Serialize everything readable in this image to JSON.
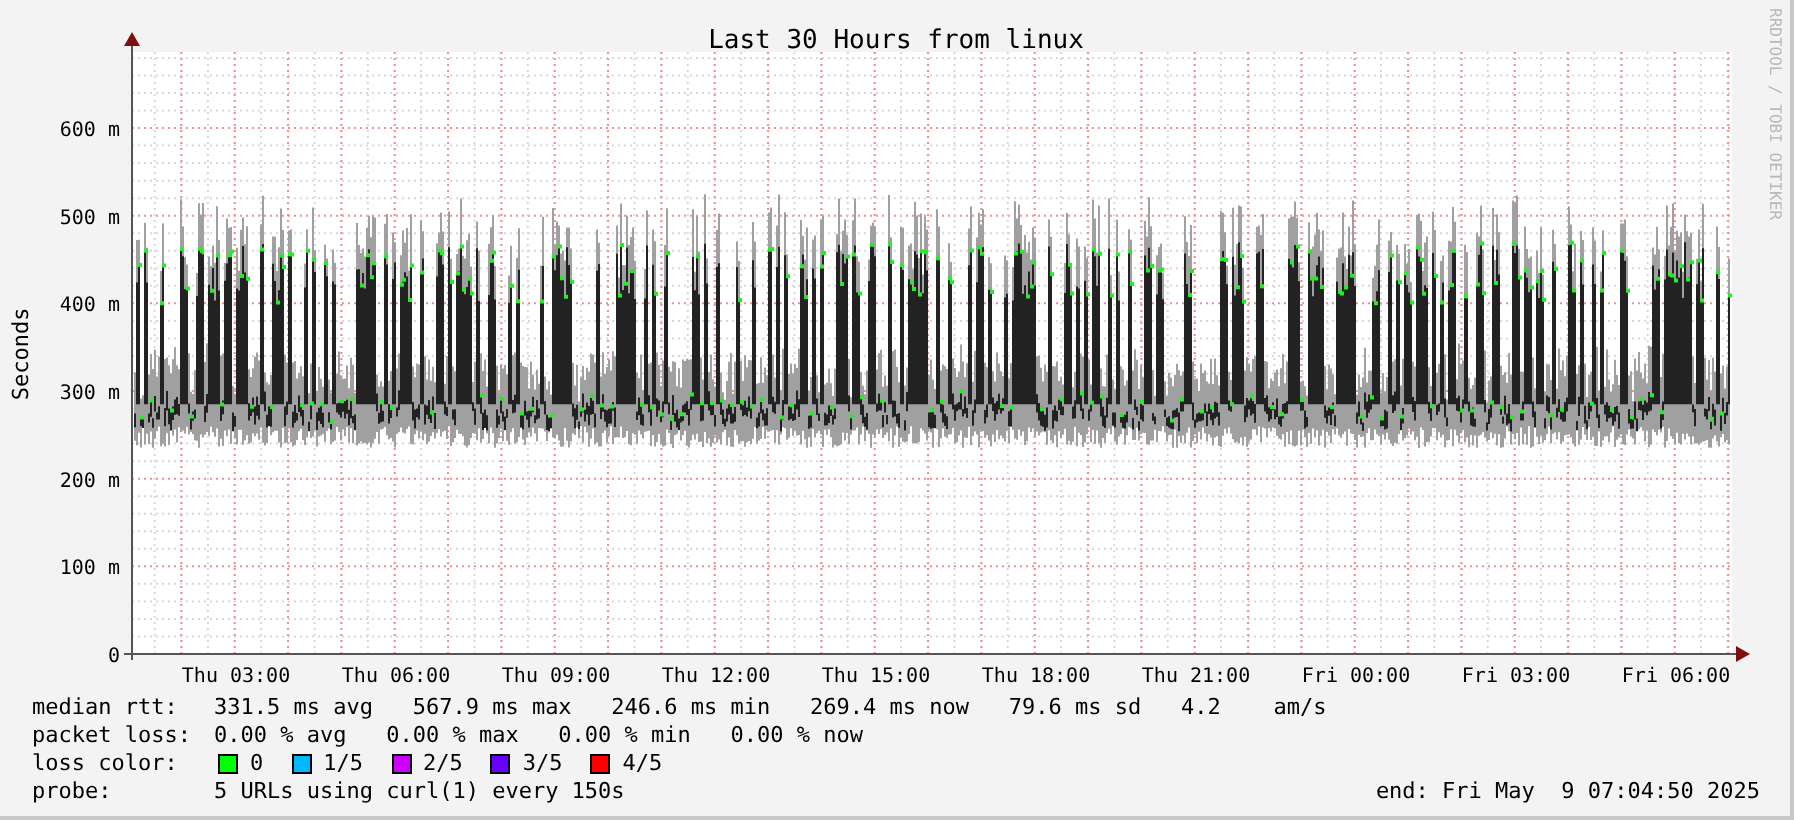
{
  "chart": {
    "title": "Last 30 Hours from linux",
    "ylabel": "Seconds",
    "credit": "RRDTOOL / TOBI OETIKER",
    "yticks": [
      "600 m",
      "500 m",
      "400 m",
      "300 m",
      "200 m",
      "100 m",
      "0"
    ],
    "xticks": [
      "Thu 03:00",
      "Thu 06:00",
      "Thu 09:00",
      "Thu 12:00",
      "Thu 15:00",
      "Thu 18:00",
      "Thu 21:00",
      "Fri 00:00",
      "Fri 03:00",
      "Fri 06:00"
    ]
  },
  "legend": {
    "median_rtt": {
      "label": "median rtt:",
      "text": "331.5 ms avg   567.9 ms max   246.6 ms min   269.4 ms now   79.6 ms sd   4.2    am/s"
    },
    "packet_loss": {
      "label": "packet loss:",
      "text": "0.00 % avg   0.00 % max   0.00 % min   0.00 % now"
    },
    "loss_color": {
      "label": "loss color:",
      "items": [
        {
          "label": "0",
          "color": "#00ff00"
        },
        {
          "label": "1/5",
          "color": "#00b8ff"
        },
        {
          "label": "2/5",
          "color": "#cc00ff"
        },
        {
          "label": "3/5",
          "color": "#6a00ff"
        },
        {
          "label": "4/5",
          "color": "#ff0000"
        }
      ]
    },
    "probe": {
      "label": "probe:",
      "text": "5 URLs using curl(1) every 150s"
    },
    "end": "end: Fri May  9 07:04:50 2025"
  }
}
